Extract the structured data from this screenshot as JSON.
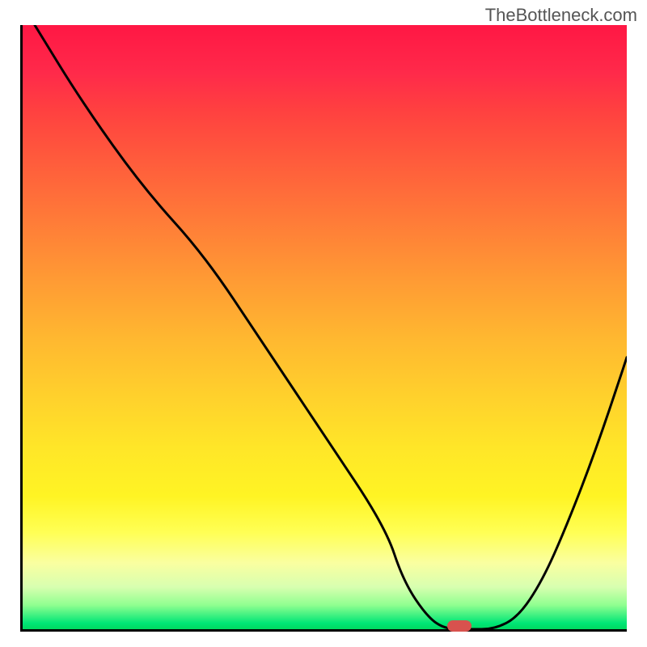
{
  "watermark": "TheBottleneck.com",
  "chart_data": {
    "type": "line",
    "title": "",
    "xlabel": "",
    "ylabel": "",
    "xlim": [
      0,
      100
    ],
    "ylim": [
      0,
      100
    ],
    "series": [
      {
        "name": "curve",
        "x": [
          2,
          10,
          20,
          30,
          40,
          50,
          60,
          63,
          67,
          70,
          74,
          78,
          82,
          86,
          90,
          95,
          100
        ],
        "y": [
          100,
          87,
          73,
          62,
          47,
          32,
          17,
          8,
          2,
          0,
          0,
          0,
          2,
          8,
          17,
          30,
          45
        ]
      }
    ],
    "marker": {
      "x": 72,
      "y": 0.5
    },
    "gradient": {
      "top": "#ff1744",
      "mid": "#ffdd28",
      "bottom": "#00e676"
    }
  }
}
